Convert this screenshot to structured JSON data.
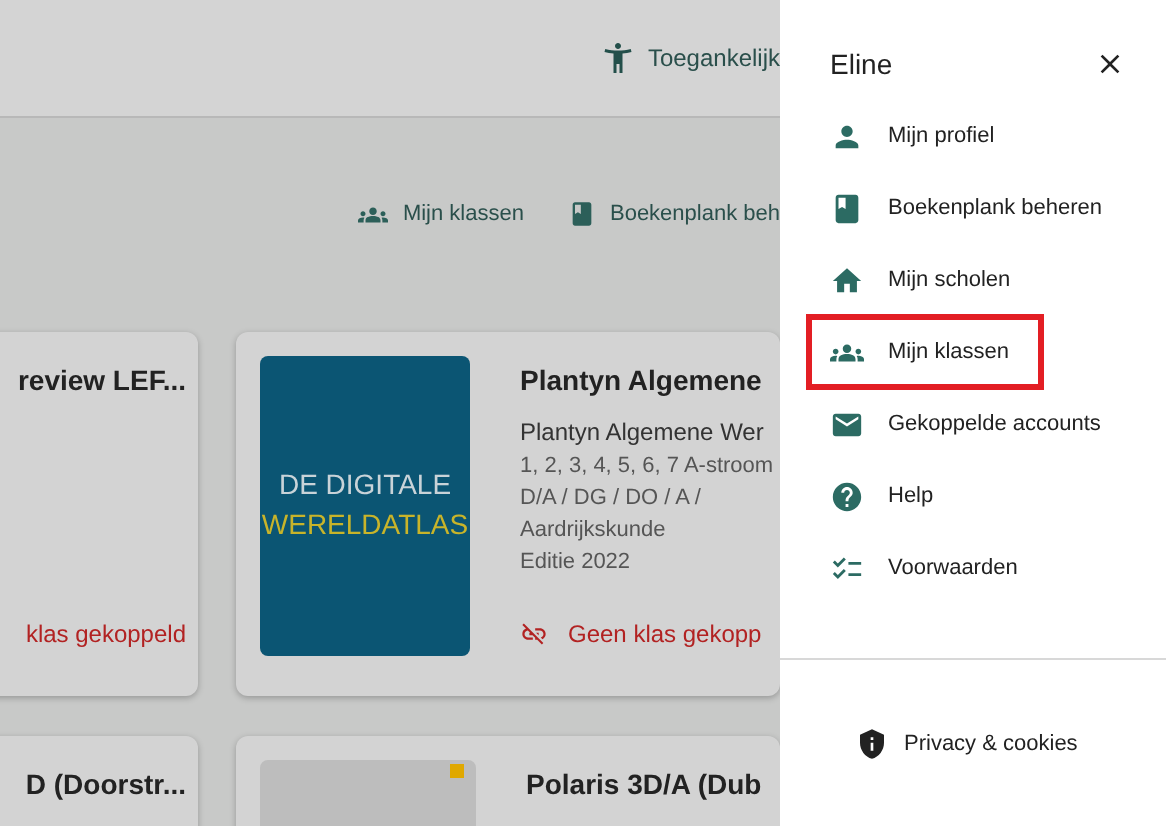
{
  "header": {
    "accessibility_link": "Toegankelijk"
  },
  "nav": [
    {
      "label": "Mijn klassen"
    },
    {
      "label": "Boekenplank beh"
    }
  ],
  "cards": [
    {
      "title": "review LEF...",
      "status": "klas gekoppeld",
      "kind": "plain"
    },
    {
      "title": "Plantyn Algemene",
      "subtitle": "Plantyn Algemene Wer",
      "details": [
        "1, 2, 3, 4, 5, 6, 7 A-stroom",
        "D/A / DG / DO / A /",
        "Aardrijkskunde",
        "Editie 2022"
      ],
      "status": "Geen klas gekopp",
      "kind": "atlas",
      "cover_lines": [
        "DE DIGITALE",
        "WERELDATLAS"
      ]
    },
    {
      "title": "D (Doorstr...",
      "kind": "plain"
    },
    {
      "title": "Polaris 3D/A (Dub",
      "kind": "photo"
    }
  ],
  "drawer": {
    "user": "Eline",
    "items": [
      {
        "label": "Mijn profiel",
        "highlighted": false
      },
      {
        "label": "Boekenplank beheren",
        "highlighted": false
      },
      {
        "label": "Mijn scholen",
        "highlighted": false
      },
      {
        "label": "Mijn klassen",
        "highlighted": true
      },
      {
        "label": "Gekoppelde accounts",
        "highlighted": false
      },
      {
        "label": "Help",
        "highlighted": false
      },
      {
        "label": "Voorwaarden",
        "highlighted": false
      }
    ],
    "footer_link": "Privacy & cookies"
  }
}
